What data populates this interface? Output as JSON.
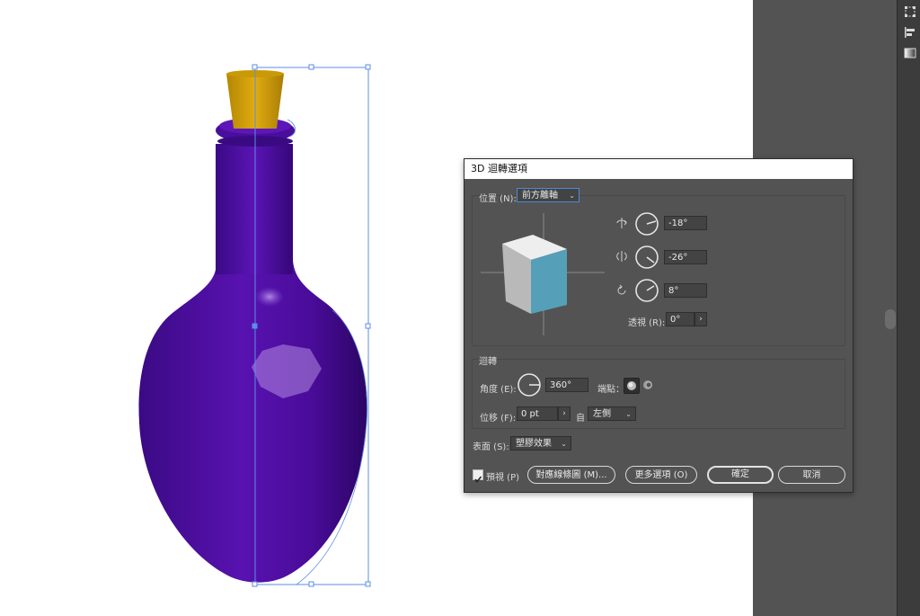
{
  "dialog": {
    "title": "3D 迴轉選項",
    "position": {
      "label": "位置 (N):",
      "value": "前方離軸"
    },
    "rotation": {
      "x_value": "-18°",
      "y_value": "-26°",
      "z_value": "8°",
      "perspective_label": "透視 (R):",
      "perspective_value": "0°"
    },
    "revolve": {
      "section_label": "迴轉",
      "angle_label": "角度 (E):",
      "angle_value": "360°",
      "cap_label": "端點：",
      "offset_label": "位移 (F):",
      "offset_value": "0 pt",
      "from_label": "自",
      "from_value": "左側"
    },
    "surface": {
      "label": "表面 (S):",
      "value": "塑膠效果"
    },
    "footer": {
      "preview_label": "預視 (P)",
      "preview_checked": true,
      "map_art_button": "對應線條圖 (M)...",
      "more_options_button": "更多選項 (O)",
      "ok_button": "確定",
      "cancel_button": "取消"
    }
  },
  "cube_colors": {
    "front": "#55a0b8",
    "top": "#eeeeee",
    "side": "#b9b9b9"
  },
  "bottle_colors": {
    "body": "#4a0c9a",
    "cork": "#c99a06"
  },
  "panel_icons": [
    "transform-icon",
    "align-icon",
    "gradient-icon"
  ]
}
